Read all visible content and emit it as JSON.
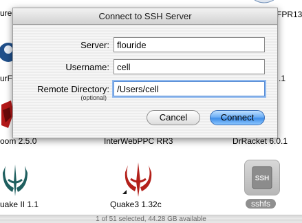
{
  "dialog": {
    "title": "Connect to SSH Server",
    "server_label": "Server:",
    "server_value": "flouride",
    "username_label": "Username:",
    "username_value": "cell",
    "remote_dir_label": "Remote Directory:",
    "remote_dir_sub": "(optional)",
    "remote_dir_value": "/Users/cell",
    "cancel_label": "Cancel",
    "connect_label": "Connect"
  },
  "finder": {
    "partial_labels": {
      "top_left": "ure",
      "top_right": "FPR13",
      "mid_left": "urFc",
      "mid_right": ".1"
    },
    "row2": {
      "left": "oom 2.5.0",
      "center": "InterWebPPC RR3",
      "right": "DrRacket 6.0.1"
    },
    "row3": {
      "left": "uake II 1.1",
      "center": "Quake3 1.32c",
      "right": "sshfs",
      "sshfs_icon_text": "SSH"
    },
    "status": "1 of 51 selected, 44.28 GB available"
  },
  "icons": {
    "quake2": "quake-logo-icon",
    "quake3": "quake3-logo-icon",
    "sshfs": "sshfs-drive-icon"
  },
  "colors": {
    "connect_button": "#4a95eb",
    "focus_ring": "#8fb8ee",
    "quake2_logo": "#1f5f5f",
    "quake3_logo": "#b3201a"
  }
}
